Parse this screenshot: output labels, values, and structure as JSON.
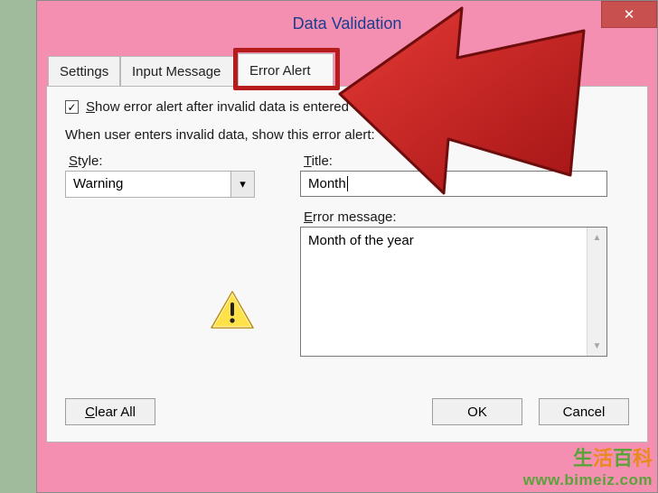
{
  "window": {
    "title": "Data Validation",
    "close_symbol": "✕"
  },
  "tabs": {
    "settings": "Settings",
    "input_message": "Input Message",
    "error_alert": "Error Alert"
  },
  "checkbox": {
    "checked_mark": "✓",
    "label": "Show error alert after invalid data is entered"
  },
  "instruction": "When user enters invalid data, show this error alert:",
  "style": {
    "label": "Style:",
    "value": "Warning"
  },
  "title_field": {
    "label": "Title:",
    "value": "Month"
  },
  "error_message": {
    "label": "Error message:",
    "value": "Month of the year"
  },
  "buttons": {
    "clear_all": "Clear All",
    "ok": "OK",
    "cancel": "Cancel"
  },
  "watermark": {
    "cn": "生活百科",
    "url": "www.bimeiz.com"
  },
  "icons": {
    "dropdown_chevron": "▾",
    "scroll_up": "▲",
    "scroll_down": "▼"
  }
}
